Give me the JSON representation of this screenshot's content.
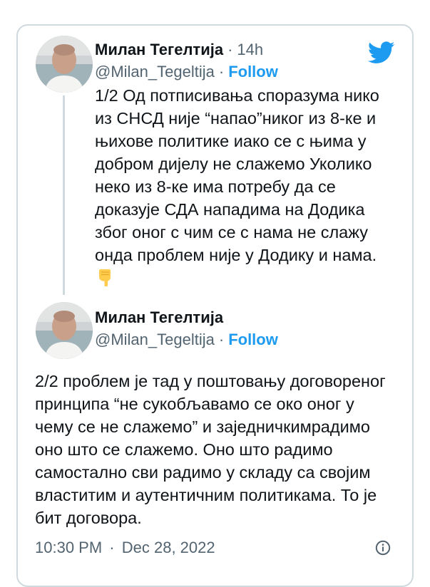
{
  "tweet1": {
    "author_name": "Милан Тегелтија",
    "handle": "@Milan_Tegeltija",
    "time": "14h",
    "follow_label": "Follow",
    "text": "1/2 Од потписивања споразума нико\nиз СНСД није “напао”никог из 8-ке и\nњихове политике иако се с њима у\nдобром дијелу не слажемо Уколико\nнеко из 8-ке има потребу да се\nдоказује СДА нападима на Додика\nзбог оног с чим се с нама не слажу\nонда проблем није у Додику и нама.",
    "emoji": "point-down-emoji"
  },
  "tweet2": {
    "author_name": "Милан Тегелтија",
    "handle": "@Milan_Tegeltija",
    "follow_label": "Follow",
    "text": "2/2 проблем је тад у поштовању договореног\nпринципа “не сукобљавамо се око оног у\nчему се не слажемо” и заједничкимрадимо\nоно што се слажемо. Оно што радимо\nсамостално сви радимо у складу са својим\nвластитим и аутентичним политикама. То је\nбит договора."
  },
  "separator": "·",
  "footer": {
    "time": "10:30 PM",
    "date": "Dec 28, 2022"
  },
  "icons": {
    "brand": "twitter-bird-icon",
    "info": "info-icon"
  },
  "colors": {
    "accent": "#1d9bf0",
    "text": "#0f1419",
    "secondary": "#536471",
    "border": "#cfd9de"
  }
}
